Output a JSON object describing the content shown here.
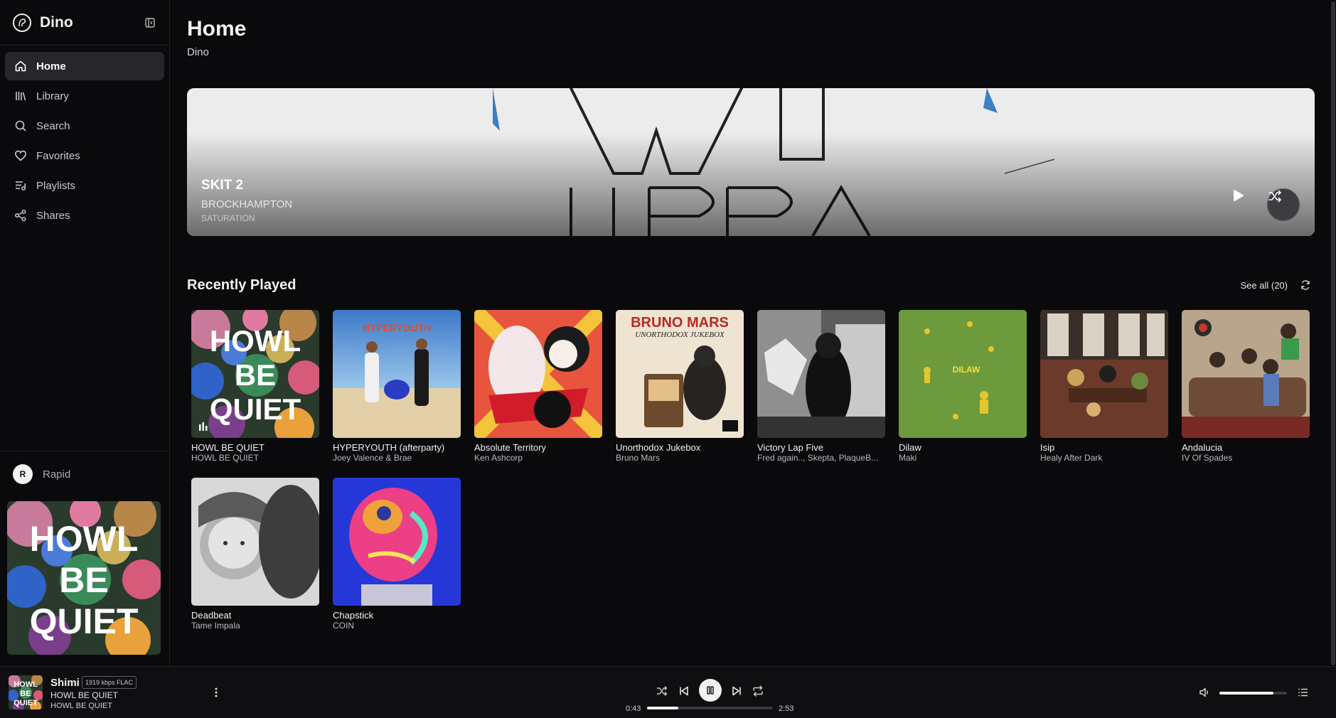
{
  "app": {
    "name": "Dino"
  },
  "sidebar": {
    "items": [
      {
        "label": "Home",
        "icon": "home-icon",
        "active": true
      },
      {
        "label": "Library",
        "icon": "library-icon"
      },
      {
        "label": "Search",
        "icon": "search-icon"
      },
      {
        "label": "Favorites",
        "icon": "heart-icon"
      },
      {
        "label": "Playlists",
        "icon": "playlist-icon"
      },
      {
        "label": "Shares",
        "icon": "share-icon"
      }
    ],
    "server": {
      "initial": "R",
      "name": "Rapid"
    },
    "now_playing_art_text": "HOWL BE QUIET"
  },
  "page": {
    "title": "Home",
    "subtitle": "Dino"
  },
  "hero": {
    "title": "SKIT 2",
    "artist": "BROCKHAMPTON",
    "album": "SATURATION"
  },
  "recent": {
    "title": "Recently Played",
    "see_all": "See all (20)",
    "items": [
      {
        "title": "HOWL BE QUIET",
        "artist": "HOWL BE QUIET"
      },
      {
        "title": "HYPERYOUTH (afterparty)",
        "artist": "Joey Valence & Brae"
      },
      {
        "title": "Absolute Territory",
        "artist": "Ken Ashcorp"
      },
      {
        "title": "Unorthodox Jukebox",
        "artist": "Bruno Mars"
      },
      {
        "title": "Victory Lap Five",
        "artist": "Fred again.., Skepta, PlaqueB..."
      },
      {
        "title": "Dilaw",
        "artist": "Maki"
      },
      {
        "title": "Isip",
        "artist": "Healy After Dark"
      },
      {
        "title": "Andalucia",
        "artist": "IV Of Spades"
      },
      {
        "title": "Deadbeat",
        "artist": "Tame Impala"
      },
      {
        "title": "Chapstick",
        "artist": "COIN"
      }
    ],
    "art_text": {
      "howl_lines": [
        "HOWL",
        "BE",
        "QUIET"
      ],
      "hyperyouth": "HYPERYOUTH",
      "bruno_1": "BRUNO MARS",
      "bruno_2": "UNORTHODOX JUKEBOX",
      "dilaw": "DILAW"
    }
  },
  "player": {
    "track": "Shimi",
    "quality": "1919 kbps FLAC",
    "album": "HOWL BE QUIET",
    "artist": "HOWL BE QUIET",
    "current_time": "0:43",
    "total_time": "2:53",
    "progress": 0.25,
    "volume": 0.8
  },
  "colors": {
    "background": "#0a0a0c",
    "accent": "#f2f2f2",
    "active_nav": "#26262b"
  }
}
